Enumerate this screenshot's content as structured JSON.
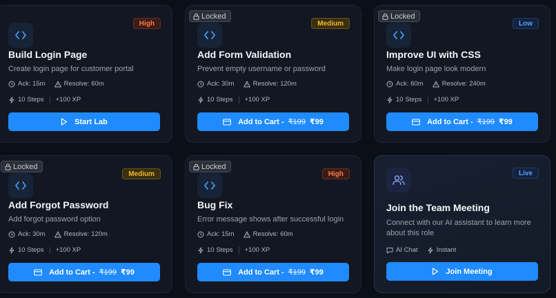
{
  "cards": [
    {
      "title": "Build Login Page",
      "description": "Create login page for customer portal",
      "difficulty": "High",
      "ack": "Ack: 15m",
      "resolve": "Resolve: 60m",
      "steps": "10 Steps",
      "xp": "+100 XP",
      "button_label": "Start Lab",
      "locked": false
    },
    {
      "title": "Add Form Validation",
      "description": "Prevent empty username or password",
      "difficulty": "Medium",
      "ack": "Ack: 30m",
      "resolve": "Resolve: 120m",
      "steps": "10 Steps",
      "xp": "+100 XP",
      "button_label": "Add to Cart -",
      "old_price": "₹199",
      "price": "₹99",
      "locked": true,
      "locked_label": "Locked"
    },
    {
      "title": "Improve UI with CSS",
      "description": "Make login page look modern",
      "difficulty": "Low",
      "ack": "Ack: 60m",
      "resolve": "Resolve: 240m",
      "steps": "10 Steps",
      "xp": "+100 XP",
      "button_label": "Add to Cart -",
      "old_price": "₹199",
      "price": "₹99",
      "locked": true,
      "locked_label": "Locked"
    },
    {
      "title": "Add Forgot Password",
      "description": "Add forgot password option",
      "difficulty": "Medium",
      "ack": "Ack: 30m",
      "resolve": "Resolve: 120m",
      "steps": "10 Steps",
      "xp": "+100 XP",
      "button_label": "Add to Cart -",
      "old_price": "₹199",
      "price": "₹99",
      "locked": true,
      "locked_label": "Locked"
    },
    {
      "title": "Bug Fix",
      "description": "Error message shows after successful login",
      "difficulty": "High",
      "ack": "Ack: 15m",
      "resolve": "Resolve: 60m",
      "steps": "10 Steps",
      "xp": "+100 XP",
      "button_label": "Add to Cart -",
      "old_price": "₹199",
      "price": "₹99",
      "locked": true,
      "locked_label": "Locked"
    }
  ],
  "meeting": {
    "title": "Join the Team Meeting",
    "badge": "Live",
    "description": "Connect with our AI assistant to learn more about this role",
    "chat_label": "AI Chat",
    "instant_label": "Instant",
    "button_label": "Join Meeting"
  },
  "colors": {
    "accent": "#1f8bff",
    "high": "#ff7a4a",
    "medium": "#f2b92d",
    "low": "#5b9cff"
  },
  "icons": {
    "card_icon": "code-icon",
    "meeting_icon": "users-icon",
    "lock": "lock-icon",
    "ack": "clock-icon",
    "resolve": "warning-icon",
    "steps": "bolt-icon",
    "start": "play-icon",
    "cart": "card-icon",
    "chat": "chat-icon",
    "instant": "bolt-icon"
  }
}
